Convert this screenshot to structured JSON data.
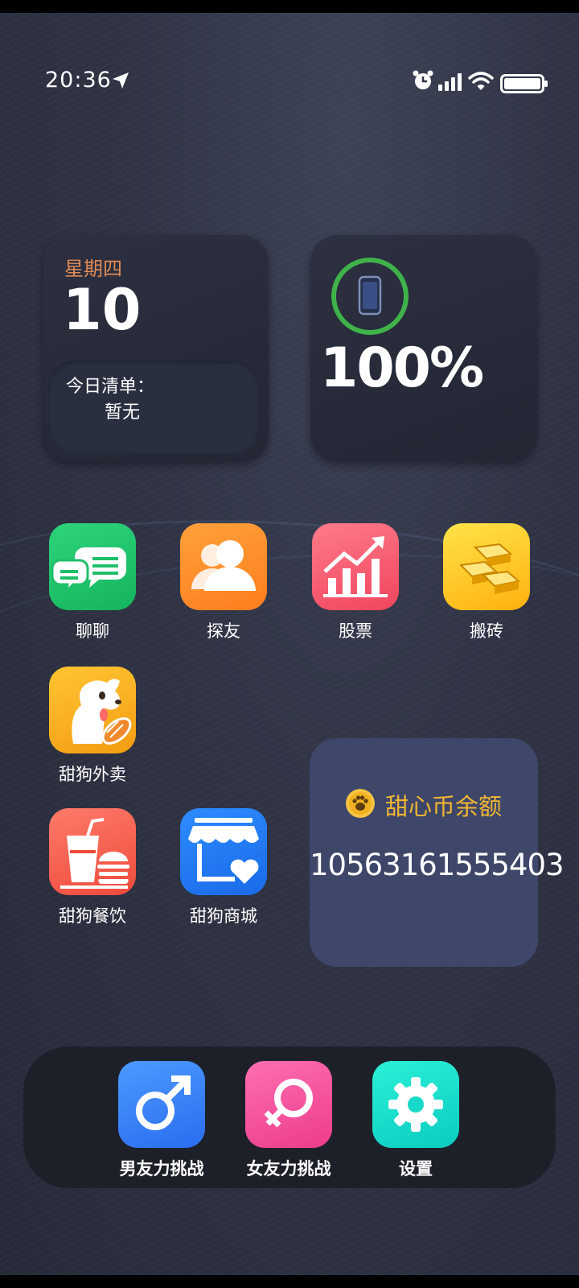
{
  "status_bar": {
    "time": "20:36",
    "icons": [
      "location-arrow-icon",
      "alarm-clock-icon",
      "signal-bars-icon",
      "wifi-icon",
      "battery-icon"
    ]
  },
  "date_widget": {
    "weekday": "星期四",
    "day": "10",
    "todo_title": "今日清单：",
    "todo_content": "暂无",
    "accent_color": "#e08a56"
  },
  "battery_widget": {
    "percent_text": "100%",
    "level": 1.0,
    "ring_color": "#3fb24a"
  },
  "apps": [
    {
      "label": "聊聊",
      "icon": "chat-bubbles-icon"
    },
    {
      "label": "探友",
      "icon": "friends-icon"
    },
    {
      "label": "股票",
      "icon": "stock-chart-icon"
    },
    {
      "label": "搬砖",
      "icon": "gold-bars-icon"
    },
    {
      "label": "甜狗外卖",
      "icon": "dog-delivery-icon"
    },
    {
      "label": "甜狗餐饮",
      "icon": "drink-burger-icon"
    },
    {
      "label": "甜狗商城",
      "icon": "store-heart-icon"
    }
  ],
  "coin_widget": {
    "title": "甜心币余额",
    "value": "10563161555403",
    "title_color": "#f3b632"
  },
  "dock": [
    {
      "label": "男友力挑战",
      "icon": "male-symbol-icon"
    },
    {
      "label": "女友力挑战",
      "icon": "female-symbol-icon"
    },
    {
      "label": "设置",
      "icon": "gear-icon"
    }
  ]
}
